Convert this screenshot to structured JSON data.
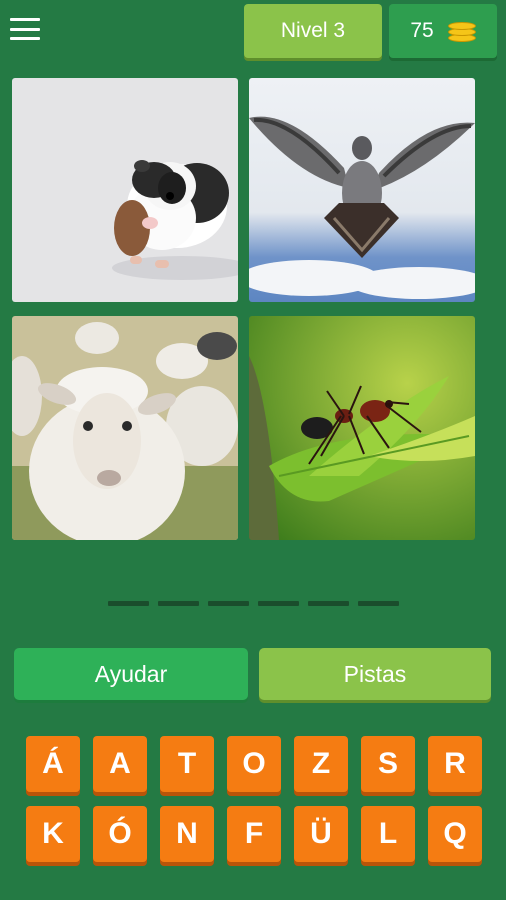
{
  "header": {
    "level_label": "Nivel 3",
    "coins": "75",
    "coin_icon": "coins-stack-icon",
    "menu_icon": "hamburger-menu-icon"
  },
  "puzzle": {
    "images": [
      "guinea-pig",
      "pigeon",
      "sheep",
      "ant"
    ],
    "answer_length": 6
  },
  "actions": {
    "help_label": "Ayudar",
    "hints_label": "Pistas"
  },
  "keyboard": {
    "row1": [
      "Á",
      "A",
      "T",
      "O",
      "Z",
      "S",
      "R"
    ],
    "row2": [
      "K",
      "Ó",
      "N",
      "F",
      "Ü",
      "L",
      "Q"
    ]
  },
  "colors": {
    "background": "#247a44",
    "key": "#f57c12",
    "help_button": "#2eb158",
    "hints_button": "#8bc34a"
  }
}
